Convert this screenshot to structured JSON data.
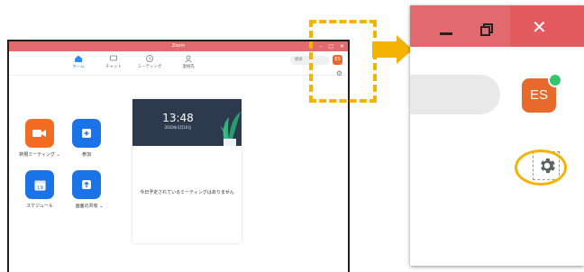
{
  "window": {
    "title": "Zoom",
    "controls": [
      "–",
      "□",
      "✕"
    ]
  },
  "nav": [
    {
      "label": "ホーム",
      "icon": "home-icon",
      "active": true
    },
    {
      "label": "チャット",
      "icon": "chat-icon",
      "active": false
    },
    {
      "label": "ミーティング",
      "icon": "clock-icon",
      "active": false
    },
    {
      "label": "連絡先",
      "icon": "contacts-icon",
      "active": false
    }
  ],
  "search": {
    "placeholder": "検索"
  },
  "user": {
    "initials": "ES"
  },
  "actions": [
    {
      "label": "新規ミーティング ⌄",
      "icon": "video-camera-icon",
      "color": "#f26d21"
    },
    {
      "label": "参加",
      "icon": "plus-icon",
      "color": "#1a74e8"
    },
    {
      "label": "スケジュール",
      "icon": "calendar-icon",
      "color": "#1a74e8"
    },
    {
      "label": "画面の共有 ⌄",
      "icon": "share-screen-icon",
      "color": "#1a74e8"
    }
  ],
  "calendar_icon_day": "19",
  "card": {
    "time": "13:48",
    "date": "2020年3月16日",
    "empty_message": "今日予定されているミーティングはありません"
  },
  "zoomed": {
    "close_glyph": "✕",
    "initials": "ES"
  },
  "colors": {
    "accent": "#f3b300",
    "titlebar": "#e06a6e",
    "avatar": "#e8692c",
    "online": "#33c66a"
  }
}
